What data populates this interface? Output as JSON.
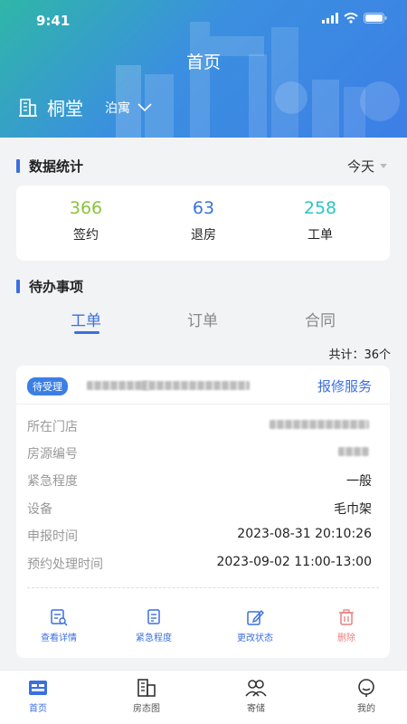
{
  "status_bar": {
    "time": "9:41"
  },
  "header": {
    "title": "首页",
    "store_name": "桐堂",
    "store_sub": "泊寓"
  },
  "stats": {
    "title": "数据统计",
    "period": "今天",
    "items": [
      {
        "value": "366",
        "label": "签约",
        "color": "#8ac43a"
      },
      {
        "value": "63",
        "label": "退房",
        "color": "#3a74d9"
      },
      {
        "value": "258",
        "label": "工单",
        "color": "#2ec4c4"
      }
    ]
  },
  "todo": {
    "title": "待办事项",
    "tabs": [
      "工单",
      "订单",
      "合同"
    ],
    "active_tab": 0,
    "total": "共计：36个"
  },
  "order": {
    "status": "待受理",
    "service": "报修服务",
    "fields": [
      {
        "key": "所在门店",
        "value": ""
      },
      {
        "key": "房源编号",
        "value": ""
      },
      {
        "key": "紧急程度",
        "value": "一般"
      },
      {
        "key": "设备",
        "value": "毛巾架"
      },
      {
        "key": "申报时间",
        "value": "2023-08-31 20:10:26"
      },
      {
        "key": "预约处理时间",
        "value": "2023-09-02 11:00-13:00"
      }
    ],
    "actions": [
      "查看详情",
      "紧急程度",
      "更改状态",
      "删除"
    ]
  },
  "nav": {
    "items": [
      "首页",
      "房态图",
      "寄储",
      "我的"
    ],
    "active": 0
  },
  "colors": {
    "accent": "#3b6fe0",
    "danger": "#e98080"
  }
}
